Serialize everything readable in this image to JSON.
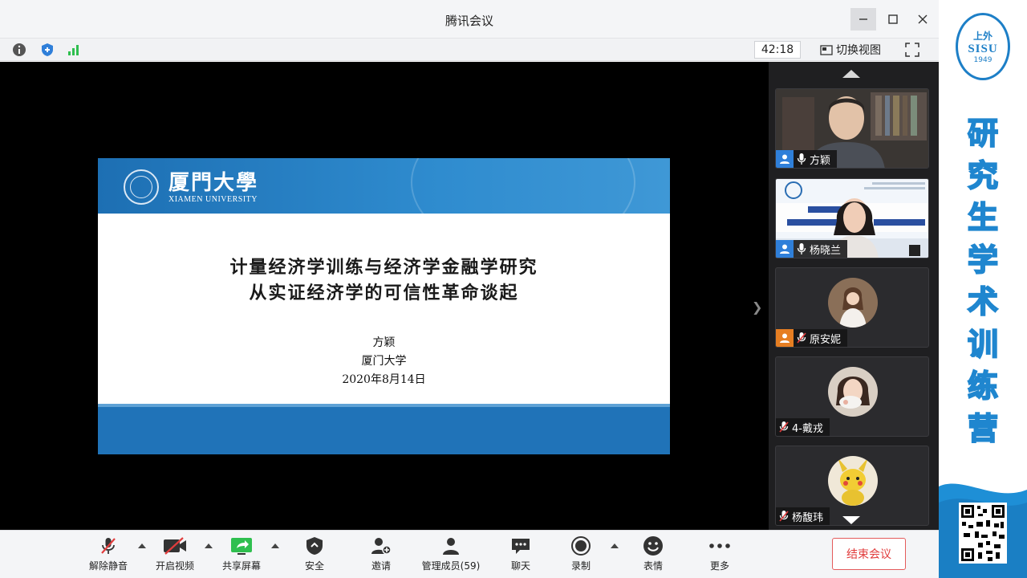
{
  "window": {
    "title": "腾讯会议"
  },
  "infobar": {
    "timer": "42:18",
    "switch_view": "切换视图"
  },
  "slide": {
    "university_cn": "厦門大學",
    "university_en": "XIAMEN UNIVERSITY",
    "title_line1": "计量经济学训练与经济学金融学研究",
    "title_line2": "从实证经济学的可信性革命谈起",
    "author": "方颖",
    "organization": "厦门大学",
    "date": "2020年8月14日"
  },
  "participants": [
    {
      "name": "方颖",
      "badge": "user-icon",
      "badge_color": "#2f7fd9",
      "mic": "microphone-icon"
    },
    {
      "name": "杨晓兰",
      "badge": "user-icon",
      "badge_color": "#2f7fd9",
      "mic": "microphone-icon"
    },
    {
      "name": "原安妮",
      "badge": "user-icon",
      "badge_color": "#e67e22",
      "mic": "microphone-muted-icon"
    },
    {
      "name": "4-戴戎",
      "badge": "",
      "mic": "microphone-muted-icon"
    },
    {
      "name": "杨馥玮",
      "badge": "",
      "mic": "microphone-muted-icon"
    }
  ],
  "toolbar": {
    "mute": "解除静音",
    "video": "开启视频",
    "share": "共享屏幕",
    "security": "安全",
    "invite": "邀请",
    "members": "管理成员(59)",
    "chat": "聊天",
    "record": "录制",
    "reactions": "表情",
    "more": "更多",
    "end_meeting": "结束会议"
  },
  "brand": {
    "logo_top": "上外",
    "logo_mid": "SISU",
    "logo_year": "1949",
    "title_chars": [
      "研",
      "究",
      "生",
      "学",
      "术",
      "训",
      "练",
      "营"
    ]
  },
  "colors": {
    "accent": "#1d7fc7",
    "end_meeting": "#e13c3c",
    "signal": "#2fbf4f"
  }
}
